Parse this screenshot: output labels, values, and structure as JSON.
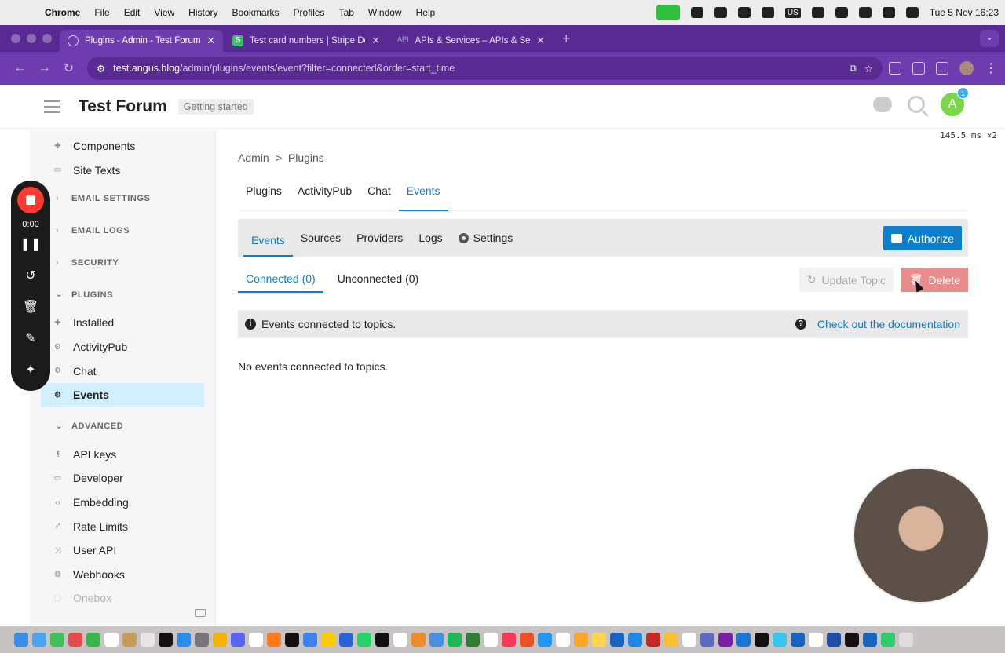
{
  "macos": {
    "app_name": "Chrome",
    "menus": [
      "File",
      "Edit",
      "View",
      "History",
      "Bookmarks",
      "Profiles",
      "Tab",
      "Window",
      "Help"
    ],
    "clock": "Tue 5 Nov  16:23",
    "input_source": "US"
  },
  "browser": {
    "tabs": [
      {
        "title": "Plugins - Admin - Test Forum",
        "active": true
      },
      {
        "title": "Test card numbers | Stripe Do",
        "active": false
      },
      {
        "title": "APIs & Services – APIs & Serv",
        "active": false
      }
    ],
    "url_host": "test.angus.blog",
    "url_path": "/admin/plugins/events/event?filter=connected&order=start_time"
  },
  "header": {
    "site_title": "Test Forum",
    "badge": "Getting started",
    "notification_count": "1",
    "avatar_letter": "A"
  },
  "timer_overlay": "145.5 ms ×2",
  "sidebar": {
    "top_items": [
      {
        "label": "Components",
        "icon": "puzzle-icon"
      },
      {
        "label": "Site Texts",
        "icon": "keyboard-icon"
      }
    ],
    "sections": {
      "email_settings": "EMAIL SETTINGS",
      "email_logs": "EMAIL LOGS",
      "security": "SECURITY",
      "plugins": "PLUGINS",
      "advanced": "ADVANCED"
    },
    "plugin_items": [
      {
        "label": "Installed",
        "icon": "puzzle-icon"
      },
      {
        "label": "ActivityPub",
        "icon": "gear-icon"
      },
      {
        "label": "Chat",
        "icon": "gear-icon"
      },
      {
        "label": "Events",
        "icon": "gear-icon",
        "active": true
      }
    ],
    "advanced_items": [
      {
        "label": "API keys",
        "icon": "key-icon"
      },
      {
        "label": "Developer",
        "icon": "keyboard-icon"
      },
      {
        "label": "Embedding",
        "icon": "code-icon"
      },
      {
        "label": "Rate Limits",
        "icon": "rocket-icon"
      },
      {
        "label": "User API",
        "icon": "shuffle-icon"
      },
      {
        "label": "Webhooks",
        "icon": "globe-icon"
      },
      {
        "label": "Onebox",
        "icon": "box-icon"
      }
    ]
  },
  "main": {
    "breadcrumb": {
      "root": "Admin",
      "sep": ">",
      "current": "Plugins"
    },
    "plugin_tabs": [
      "Plugins",
      "ActivityPub",
      "Chat",
      "Events"
    ],
    "active_plugin_tab": "Events",
    "subnav": [
      "Events",
      "Sources",
      "Providers",
      "Logs",
      "Settings"
    ],
    "authorize_label": "Authorize",
    "filters": [
      "Connected (0)",
      "Unconnected (0)"
    ],
    "update_topic_label": "Update Topic",
    "delete_label": "Delete",
    "alert_text": "Events connected to topics.",
    "doc_link": "Check out the documentation",
    "empty_text": "No events connected to topics."
  },
  "recorder": {
    "time": "0:00"
  },
  "colors": {
    "accent": "#0b7fcd",
    "chrome": "#5a2a94",
    "active_sidebar": "#d1efff",
    "delete": "#e98c8c"
  }
}
